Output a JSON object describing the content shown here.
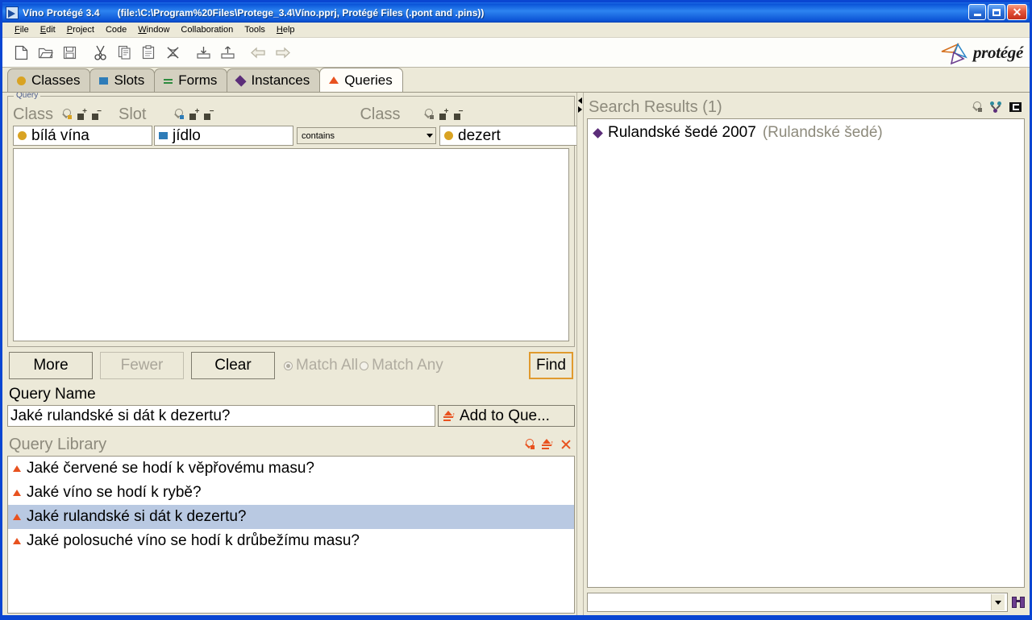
{
  "window": {
    "title": "Víno  Protégé 3.4",
    "file_info": "(file:\\C:\\Program%20Files\\Protege_3.4\\Víno.pprj, Protégé Files (.pont and .pins))",
    "title_icon": "protege-app-icon",
    "buttons": {
      "minimize": "minimize-button",
      "maximize": "maximize-button",
      "close": "close-button"
    }
  },
  "menu": {
    "items": [
      {
        "label": "File"
      },
      {
        "label": "Edit"
      },
      {
        "label": "Project"
      },
      {
        "label": "Code"
      },
      {
        "label": "Window"
      },
      {
        "label": "Collaboration"
      },
      {
        "label": "Tools"
      },
      {
        "label": "Help"
      }
    ]
  },
  "toolbar": {
    "buttons": [
      {
        "icon": "new-project-icon"
      },
      {
        "icon": "open-project-icon"
      },
      {
        "icon": "save-project-icon"
      },
      {
        "icon": "cut-icon"
      },
      {
        "icon": "copy-icon"
      },
      {
        "icon": "paste-icon"
      },
      {
        "icon": "delete-icon"
      },
      {
        "icon": "import-icon"
      },
      {
        "icon": "export-icon"
      },
      {
        "icon": "undo-icon"
      },
      {
        "icon": "redo-icon"
      }
    ],
    "logo_text": "protégé"
  },
  "tabs": [
    {
      "label": "Classes",
      "icon": "class-circle-icon",
      "active": false
    },
    {
      "label": "Slots",
      "icon": "slot-square-icon",
      "active": false
    },
    {
      "label": "Forms",
      "icon": "form-equals-icon",
      "active": false
    },
    {
      "label": "Instances",
      "icon": "instance-diamond-icon",
      "active": false
    },
    {
      "label": "Queries",
      "icon": "query-triangle-icon",
      "active": true
    }
  ],
  "query_panel": {
    "legend": "Query",
    "columns": [
      {
        "label": "Class",
        "icons": [
          "find-class-icon",
          "add-class-icon",
          "remove-class-icon"
        ]
      },
      {
        "label": "Slot",
        "icons": [
          "find-slot-icon",
          "add-slot-icon",
          "remove-slot-icon"
        ]
      },
      {
        "label": "Class",
        "icons": [
          "find-class-icon",
          "add-class-icon",
          "remove-class-icon"
        ]
      }
    ],
    "row": {
      "class_value": "bílá vína",
      "slot_value": "jídlo",
      "operator_value": "contains",
      "value_class": "dezert"
    },
    "buttons": {
      "more": "More",
      "fewer": "Fewer",
      "clear": "Clear",
      "find": "Find"
    },
    "match_all": "Match All",
    "match_any": "Match Any",
    "match_all_selected": true
  },
  "query_name": {
    "label": "Query Name",
    "value": "Jaké rulandské si dát k dezertu?",
    "add_button": "Add to Que...",
    "add_button_icon": "add-to-library-icon"
  },
  "query_library": {
    "title": "Query Library",
    "icons": [
      "find-query-icon",
      "add-query-icon",
      "remove-query-icon"
    ],
    "items": [
      {
        "label": "Jaké červené se hodí k věpřovému masu?",
        "selected": false
      },
      {
        "label": "Jaké víno se hodí k rybě?",
        "selected": false
      },
      {
        "label": "Jaké rulandské si dát k dezertu?",
        "selected": true
      },
      {
        "label": "Jaké polosuché víno se hodí k drůbežímu masu?",
        "selected": false
      }
    ]
  },
  "search_results": {
    "title": "Search Results (1)",
    "icons": [
      "find-instance-icon",
      "view-hierarchy-icon",
      "display-form-icon"
    ],
    "items": [
      {
        "name": "Rulandské šedé 2007",
        "class": "(Rulandské šedé)"
      }
    ],
    "footer": {
      "combo_value": "",
      "search_icon": "binoculars-icon"
    }
  },
  "colors": {
    "titlebar_blue": "#0a53d8",
    "class_gold": "#d9a323",
    "slot_blue": "#2e7cb8",
    "form_green": "#2e8b3f",
    "instance_purple": "#5b2d79",
    "query_orange": "#e8521f",
    "selection_blue": "#b9c9e2",
    "panel_beige": "#ece9d8",
    "focus_orange": "#e09a2e"
  }
}
